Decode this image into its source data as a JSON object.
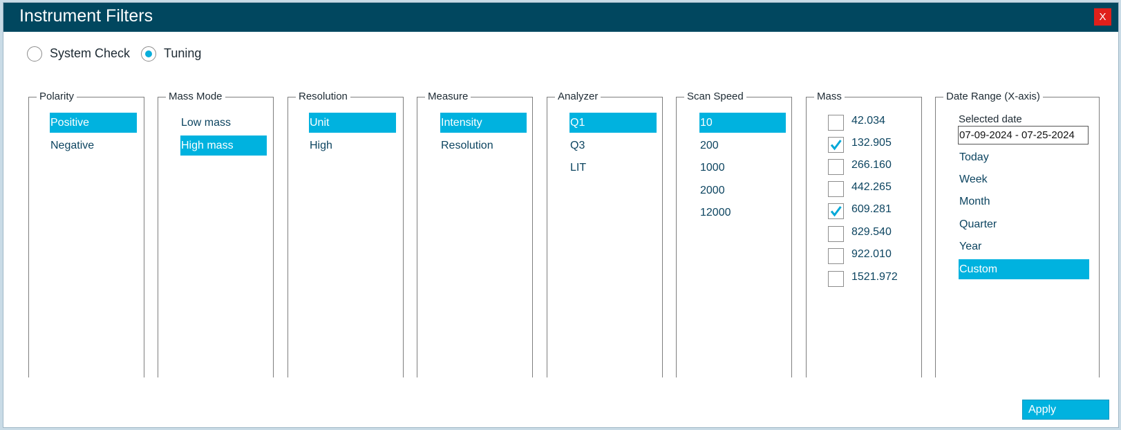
{
  "window": {
    "title": "Instrument Filters",
    "close_label": "X"
  },
  "mode": {
    "options": [
      {
        "label": "System Check",
        "selected": false
      },
      {
        "label": "Tuning",
        "selected": true
      }
    ]
  },
  "groups": {
    "polarity": {
      "title": "Polarity",
      "items": [
        {
          "label": "Positive",
          "selected": true
        },
        {
          "label": "Negative",
          "selected": false
        }
      ]
    },
    "mass_mode": {
      "title": "Mass Mode",
      "items": [
        {
          "label": "Low mass",
          "selected": false
        },
        {
          "label": "High mass",
          "selected": true
        }
      ]
    },
    "resolution": {
      "title": "Resolution",
      "items": [
        {
          "label": "Unit",
          "selected": true
        },
        {
          "label": "High",
          "selected": false
        }
      ]
    },
    "measure": {
      "title": "Measure",
      "items": [
        {
          "label": "Intensity",
          "selected": true
        },
        {
          "label": "Resolution",
          "selected": false
        }
      ]
    },
    "analyzer": {
      "title": "Analyzer",
      "items": [
        {
          "label": "Q1",
          "selected": true
        },
        {
          "label": "Q3",
          "selected": false
        },
        {
          "label": "LIT",
          "selected": false
        }
      ]
    },
    "scan_speed": {
      "title": "Scan Speed",
      "items": [
        {
          "label": "10",
          "selected": true
        },
        {
          "label": "200",
          "selected": false
        },
        {
          "label": "1000",
          "selected": false
        },
        {
          "label": "2000",
          "selected": false
        },
        {
          "label": "12000",
          "selected": false
        }
      ]
    },
    "mass": {
      "title": "Mass",
      "items": [
        {
          "label": "42.034",
          "checked": false
        },
        {
          "label": "132.905",
          "checked": true
        },
        {
          "label": "266.160",
          "checked": false
        },
        {
          "label": "442.265",
          "checked": false
        },
        {
          "label": "609.281",
          "checked": true
        },
        {
          "label": "829.540",
          "checked": false
        },
        {
          "label": "922.010",
          "checked": false
        },
        {
          "label": "1521.972",
          "checked": false
        }
      ]
    },
    "date_range": {
      "title": "Date Range (X-axis)",
      "selected_date_label": "Selected date",
      "selected_date_value": "07-09-2024 - 07-25-2024",
      "items": [
        {
          "label": "Today",
          "selected": false
        },
        {
          "label": "Week",
          "selected": false
        },
        {
          "label": "Month",
          "selected": false
        },
        {
          "label": "Quarter",
          "selected": false
        },
        {
          "label": "Year",
          "selected": false
        },
        {
          "label": "Custom",
          "selected": true
        }
      ]
    }
  },
  "apply_label": "Apply",
  "colors": {
    "title_bar": "#01475f",
    "accent": "#00b2df",
    "close": "#e0201b",
    "text": "#0c4460"
  }
}
